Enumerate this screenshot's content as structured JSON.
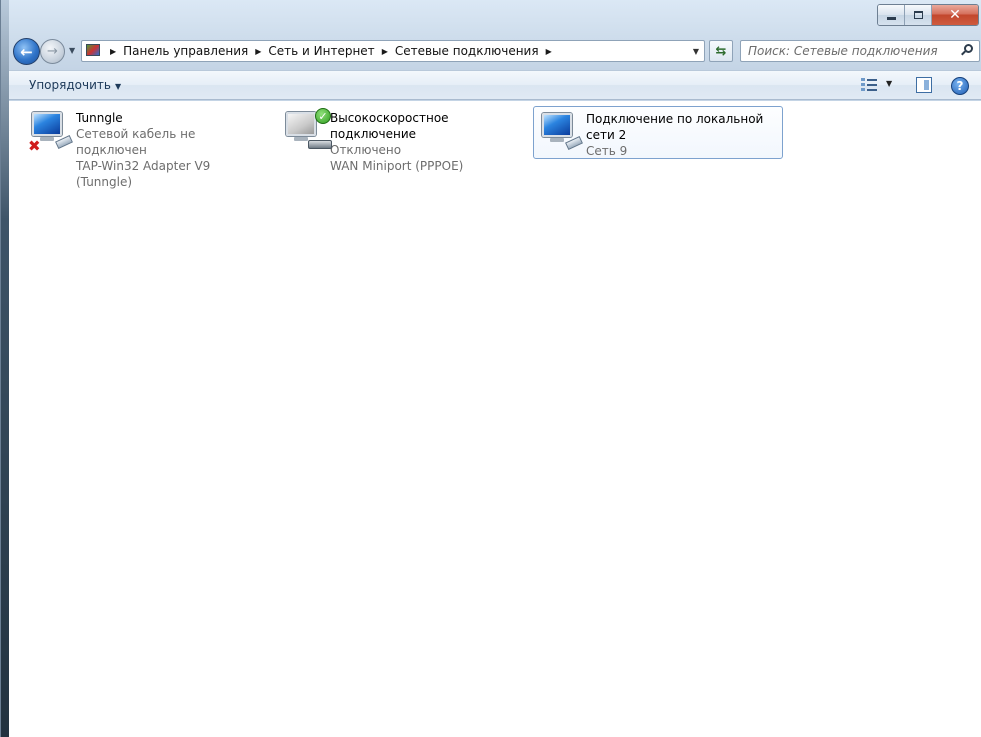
{
  "window": {
    "caption": {
      "minimize": "",
      "maximize": "",
      "close": "✕"
    }
  },
  "navbar": {
    "breadcrumb": [
      "Панель управления",
      "Сеть и Интернет",
      "Сетевые подключения"
    ],
    "search_placeholder": "Поиск: Сетевые подключения"
  },
  "toolbar": {
    "organize_label": "Упорядочить"
  },
  "connections": [
    {
      "name": "Tunngle",
      "status": "Сетевой кабель не подключен",
      "device": "TAP-Win32 Adapter V9 (Tunngle)",
      "badge": "error",
      "selected": false
    },
    {
      "name": "Высокоскоростное подключение",
      "status": "Отключено",
      "device": "WAN Miniport (PPPOE)",
      "badge": "check",
      "selected": false
    },
    {
      "name": "Подключение по локальной сети 2",
      "status": "Сеть  9",
      "device": "",
      "badge": "none",
      "selected": true
    }
  ],
  "icons": {
    "back": "back-arrow-icon",
    "forward": "forward-arrow-icon",
    "refresh": "refresh-icon",
    "search": "search-icon",
    "view": "change-view-icon",
    "preview_pane": "preview-pane-icon",
    "help": "help-icon"
  }
}
